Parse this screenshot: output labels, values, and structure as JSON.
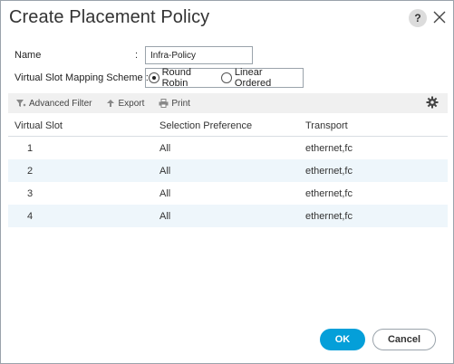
{
  "dialog": {
    "title": "Create Placement Policy",
    "help_label": "?"
  },
  "form": {
    "name_label": "Name",
    "colon": ":",
    "name_value": "Infra-Policy",
    "scheme_label": "Virtual Slot Mapping Scheme :",
    "scheme_options": [
      {
        "label": "Round Robin",
        "selected": true
      },
      {
        "label": "Linear Ordered",
        "selected": false
      }
    ]
  },
  "toolbar": {
    "advanced_filter": "Advanced Filter",
    "export": "Export",
    "print": "Print",
    "icons": [
      "filter-icon",
      "export-icon",
      "print-icon",
      "gear-icon"
    ]
  },
  "table": {
    "columns": [
      "Virtual Slot",
      "Selection Preference",
      "Transport"
    ],
    "rows": [
      [
        "1",
        "All",
        "ethernet,fc"
      ],
      [
        "2",
        "All",
        "ethernet,fc"
      ],
      [
        "3",
        "All",
        "ethernet,fc"
      ],
      [
        "4",
        "All",
        "ethernet,fc"
      ]
    ]
  },
  "footer": {
    "ok_label": "OK",
    "cancel_label": "Cancel"
  },
  "colors": {
    "accent": "#049fd9",
    "row_alt": "#eef6fb",
    "toolbar_bg": "#f0f0f0"
  }
}
